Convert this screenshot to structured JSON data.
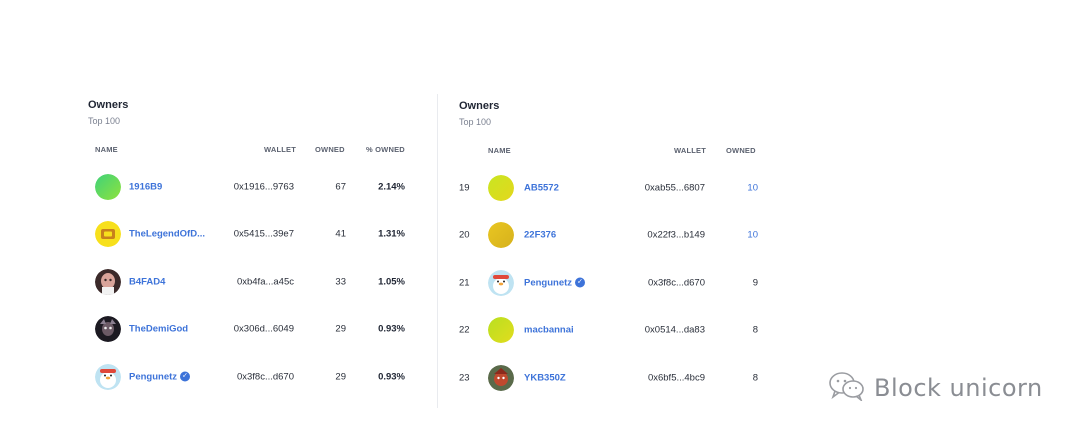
{
  "left": {
    "title": "Owners",
    "subtitle": "Top 100",
    "columns": {
      "name": "NAME",
      "wallet": "WALLET",
      "owned": "OWNED",
      "pct": "% OWNED"
    },
    "rows": [
      {
        "name": "1916B9",
        "wallet": "0x1916...9763",
        "owned": "67",
        "pct": "2.14%",
        "avatar": "green-gradient-avatar"
      },
      {
        "name": "TheLegendOfD...",
        "wallet": "0x5415...39e7",
        "owned": "41",
        "pct": "1.31%",
        "avatar": "yellow-emblem-avatar"
      },
      {
        "name": "B4FAD4",
        "wallet": "0xb4fa...a45c",
        "owned": "33",
        "pct": "1.05%",
        "avatar": "portrait-avatar"
      },
      {
        "name": "TheDemiGod",
        "wallet": "0x306d...6049",
        "owned": "29",
        "pct": "0.93%",
        "avatar": "dark-character-avatar"
      },
      {
        "name": "Pengunetz",
        "wallet": "0x3f8c...d670",
        "owned": "29",
        "pct": "0.93%",
        "avatar": "penguin-avatar",
        "verified": true
      }
    ]
  },
  "right": {
    "title": "Owners",
    "subtitle": "Top 100",
    "columns": {
      "name": "NAME",
      "wallet": "WALLET",
      "owned": "OWNED"
    },
    "rows": [
      {
        "rank": "19",
        "name": "AB5572",
        "wallet": "0xab55...6807",
        "owned": "10",
        "avatar": "lime-gradient-avatar"
      },
      {
        "rank": "20",
        "name": "22F376",
        "wallet": "0x22f3...b149",
        "owned": "10",
        "avatar": "gold-gradient-avatar"
      },
      {
        "rank": "21",
        "name": "Pengunetz",
        "wallet": "0x3f8c...d670",
        "owned": "9",
        "avatar": "penguin-avatar",
        "verified": true
      },
      {
        "rank": "22",
        "name": "macbannai",
        "wallet": "0x0514...da83",
        "owned": "8",
        "avatar": "lime-gradient-avatar"
      },
      {
        "rank": "23",
        "name": "YKB350Z",
        "wallet": "0x6bf5...4bc9",
        "owned": "8",
        "avatar": "character-avatar"
      }
    ]
  },
  "watermark": {
    "text": "Block unicorn",
    "icon": "wechat-icon"
  },
  "colors": {
    "link": "#3d73d9",
    "text": "#1f2533",
    "muted": "#7b8190"
  }
}
